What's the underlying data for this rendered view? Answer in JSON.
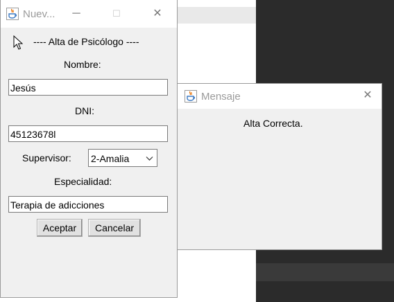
{
  "window_alta": {
    "title": "Nuev...",
    "minimize": "─",
    "maximize": "☐",
    "close": "✕",
    "heading": "---- Alta de Psicólogo ----",
    "nombre_label": "Nombre:",
    "nombre_value": "Jesús",
    "dni_label": "DNI:",
    "dni_value": "45123678l",
    "supervisor_label": "Supervisor:",
    "supervisor_value": "2-Amalia",
    "especialidad_label": "Especialidad:",
    "especialidad_value": "Terapia de adicciones",
    "accept_label": "Aceptar",
    "cancel_label": "Cancelar"
  },
  "window_mensaje": {
    "title": "Mensaje",
    "close": "✕",
    "message": "Alta Correcta."
  },
  "icons": {
    "app": "java-cup-icon",
    "cursor": "mouse-pointer-icon"
  },
  "colors": {
    "java_blue": "#3a78c2",
    "java_orange": "#e76f00",
    "background_dark": "#2b2b2b",
    "window_bg": "#f0f0f0"
  }
}
